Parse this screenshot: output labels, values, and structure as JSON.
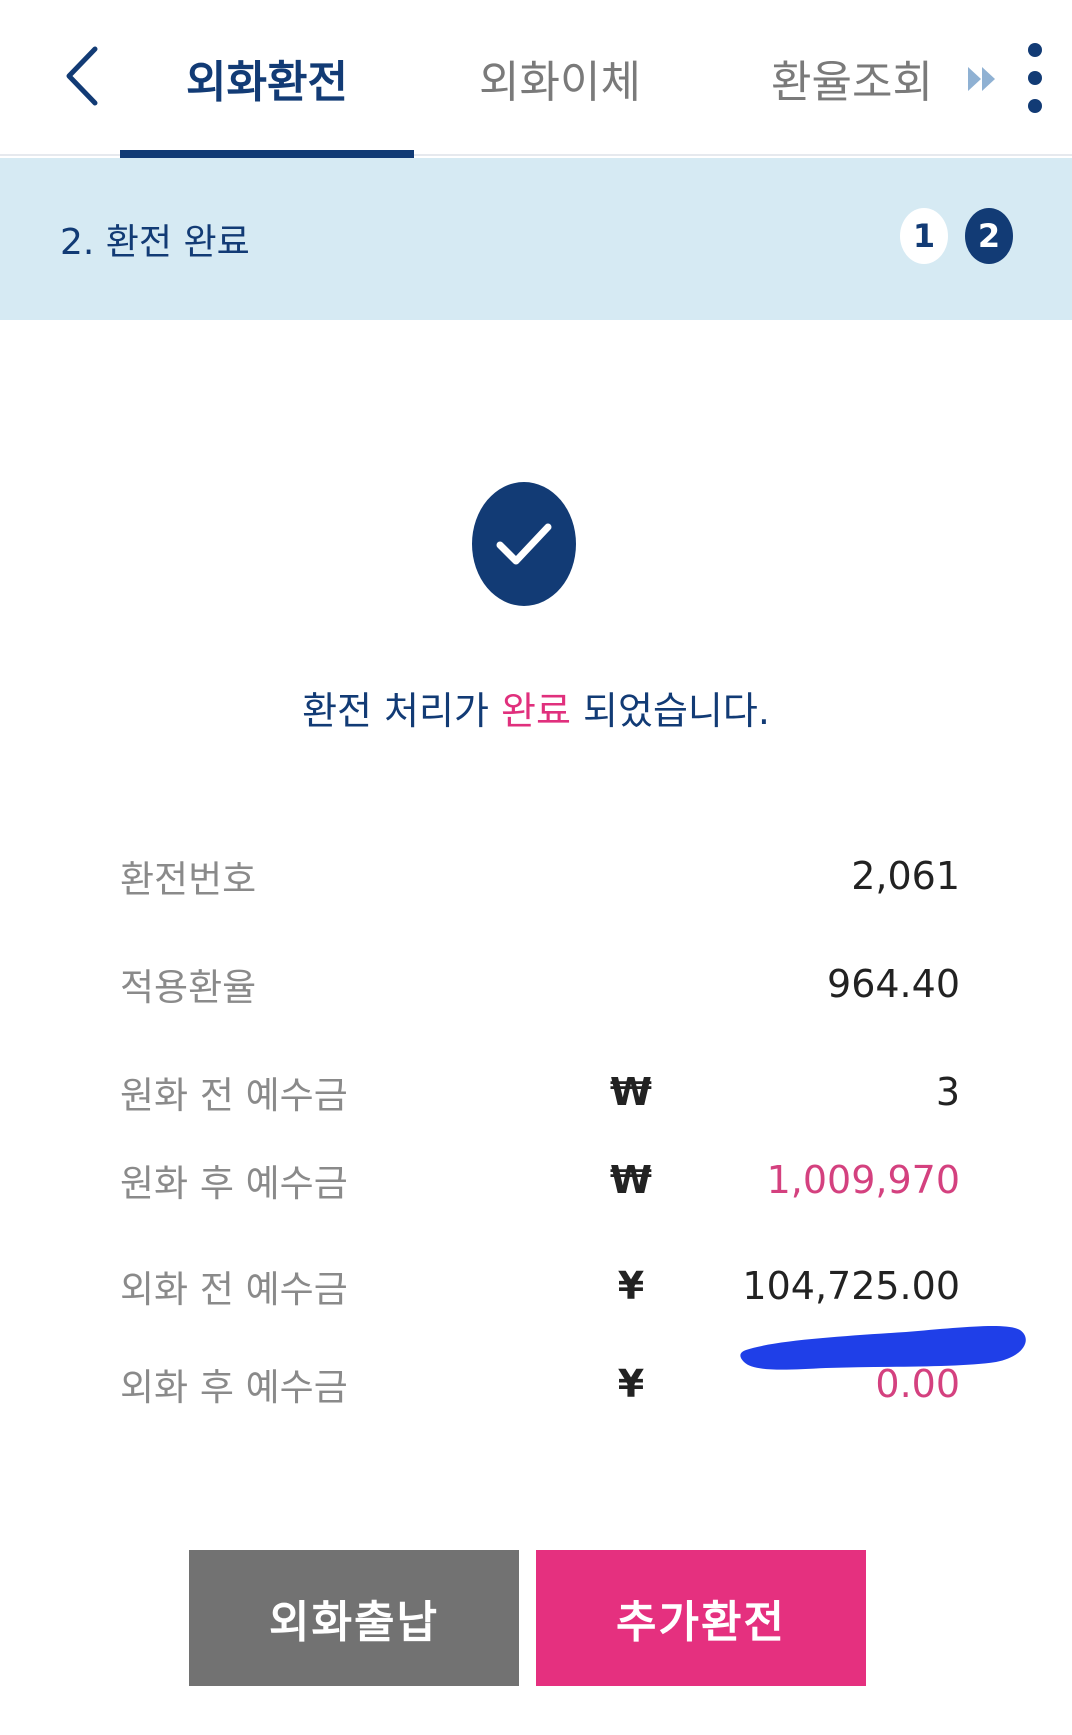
{
  "nav": {
    "tabs": [
      {
        "label": "외화환전"
      },
      {
        "label": "외화이체"
      },
      {
        "label": "환율조회"
      }
    ]
  },
  "banner": {
    "title": "2. 환전 완료",
    "steps": [
      "1",
      "2"
    ]
  },
  "message": {
    "before": "환전 처리가 ",
    "highlight": "완료",
    "after": " 되었습니다."
  },
  "details": [
    {
      "label": "환전번호",
      "currency": "",
      "value": "2,061"
    },
    {
      "label": "적용환율",
      "currency": "",
      "value": "964.40"
    },
    {
      "label": "원화 전 예수금",
      "currency": "₩",
      "value": "3"
    },
    {
      "label": "원화 후 예수금",
      "currency": "₩",
      "value": "1,009,970"
    },
    {
      "label": "외화 전 예수금",
      "currency": "¥",
      "value": "104,725.00"
    },
    {
      "label": "외화 후 예수금",
      "currency": "¥",
      "value": "0.00"
    }
  ],
  "buttons": {
    "primary_left": "외화출납",
    "primary_right": "추가환전"
  },
  "colors": {
    "navy": "#123b75",
    "pink": "#e5307f",
    "banner_bg": "#d6eaf3",
    "scribble": "#1f3fe8"
  },
  "icons": [
    "chevron-left-icon",
    "double-chevron-right-icon",
    "kebab-menu-icon",
    "check-circle-icon"
  ]
}
